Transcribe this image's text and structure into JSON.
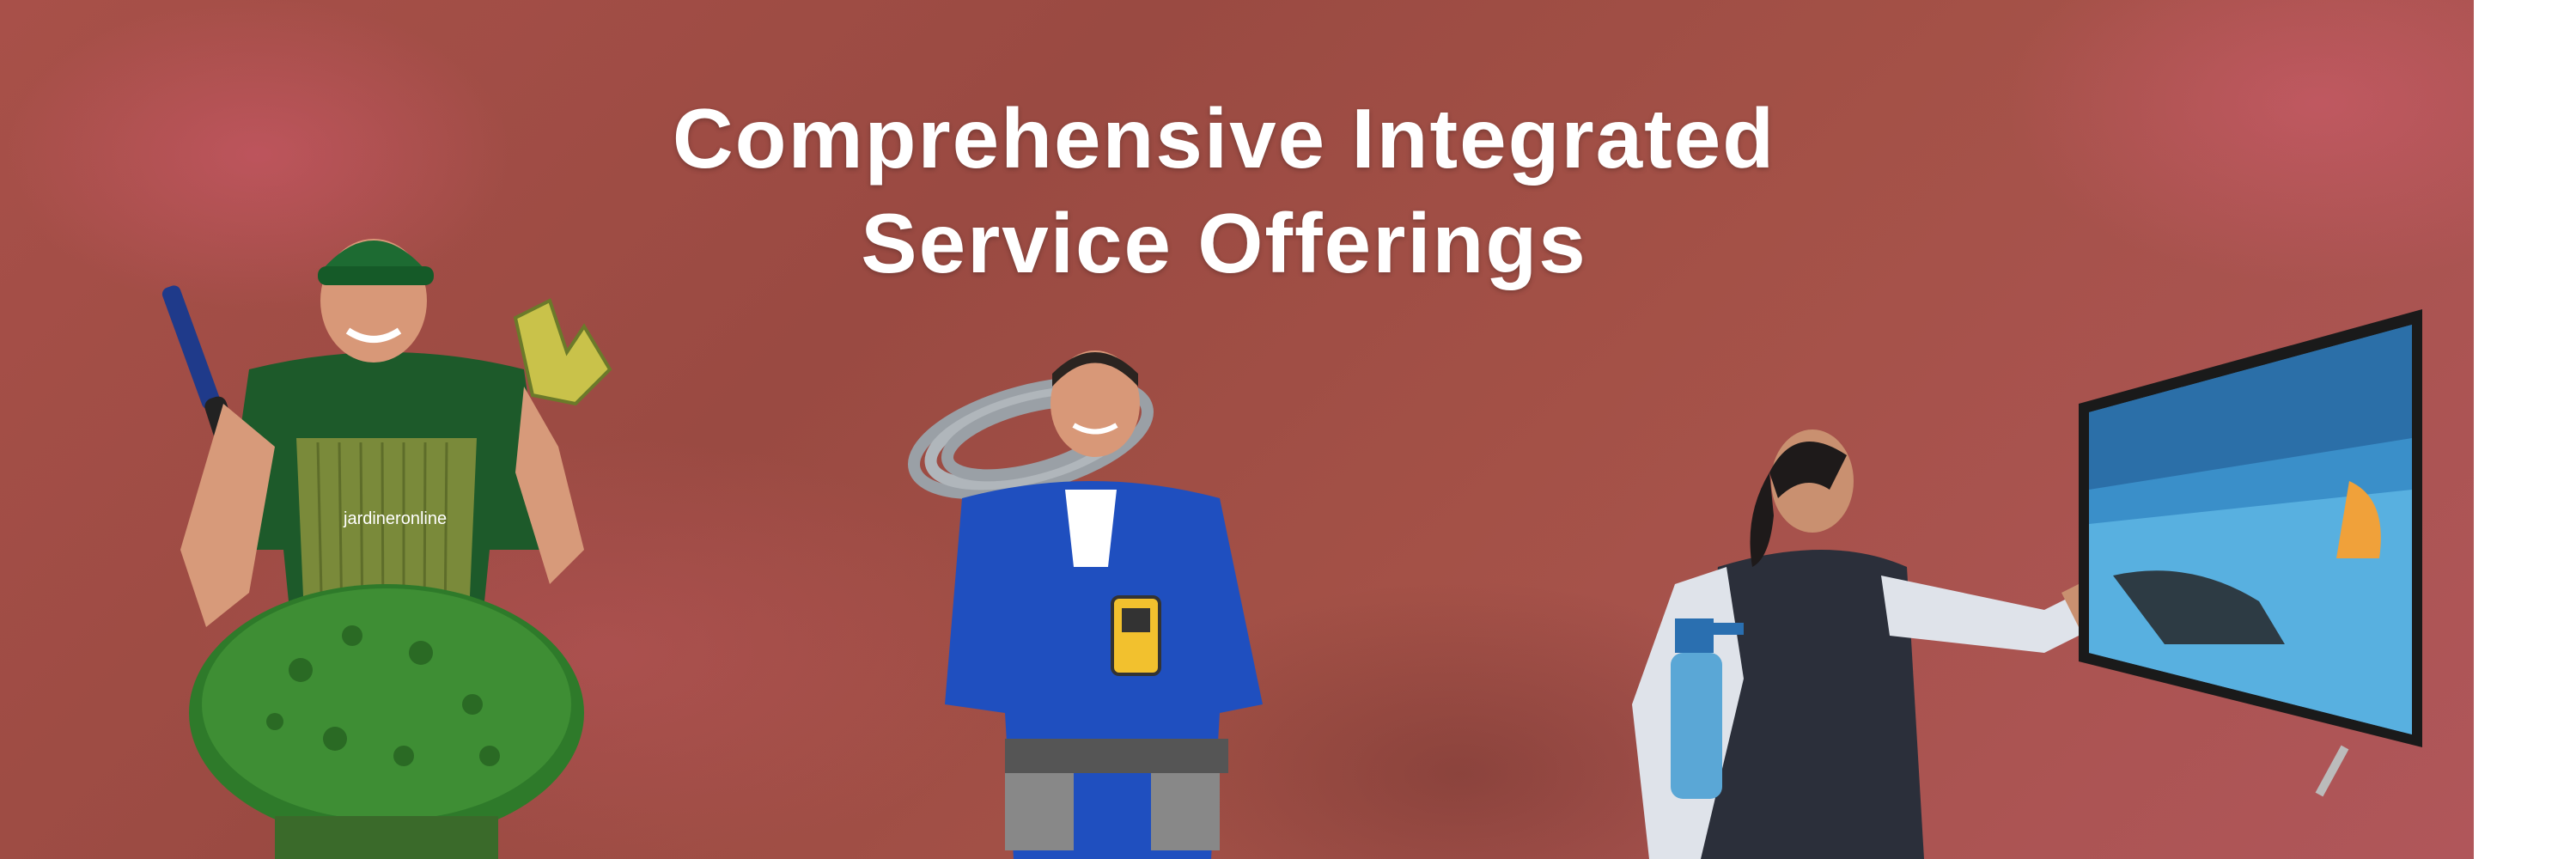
{
  "banner": {
    "headline_line1": "Comprehensive Integrated",
    "headline_line2": "Service Offerings",
    "shirt_logo_text": "jardineronline",
    "background_color": "#a24e47",
    "headline_color": "#ffffff"
  },
  "illustrations": {
    "gardener": "gardener-with-hedge-trimmer",
    "electrician": "electrician-with-cable-coil",
    "cleaner": "cleaner-wiping-tv-screen"
  }
}
